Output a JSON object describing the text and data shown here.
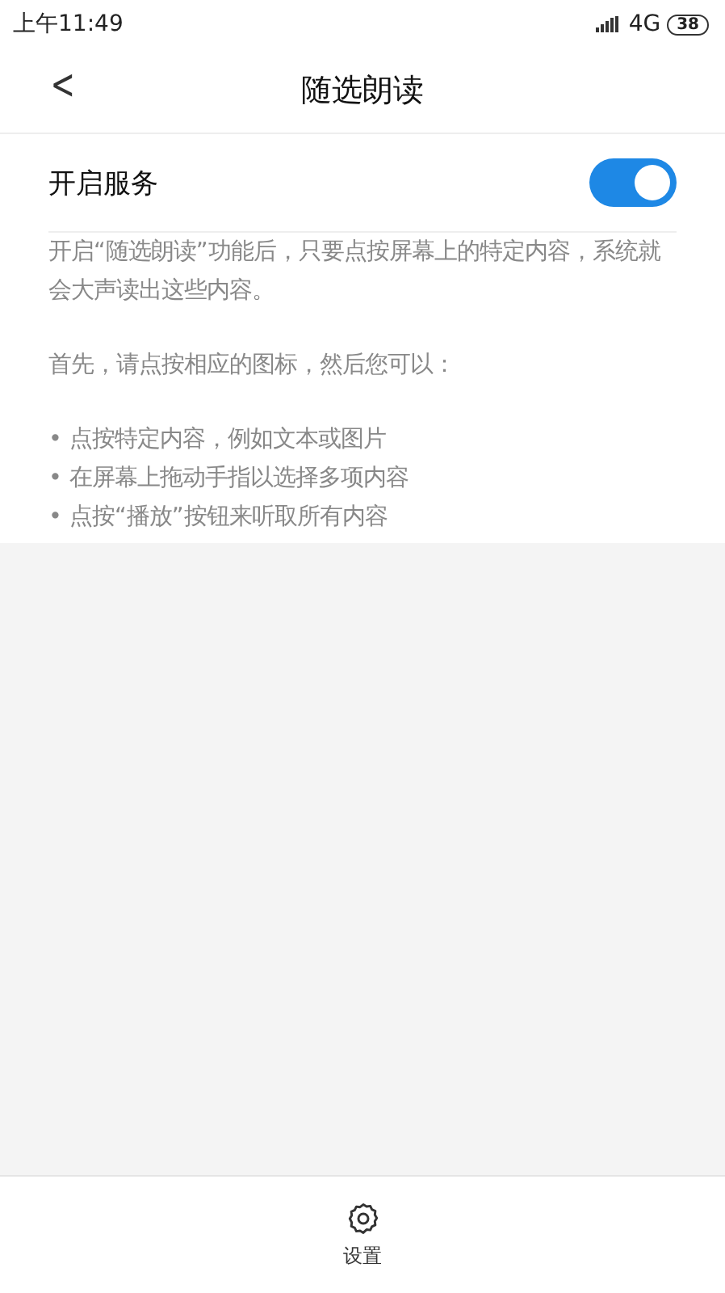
{
  "status_bar": {
    "time": "上午11:49",
    "network": "4G",
    "battery": "38"
  },
  "header": {
    "back": "<",
    "title": "随选朗读"
  },
  "service": {
    "label": "开启服务",
    "on": true
  },
  "description": [
    "开启“随选朗读”功能后，只要点按屏幕上的特定内容，系统就会大声读出这些内容。",
    "首先，请点按相应的图标，然后您可以："
  ],
  "bullets": [
    "• 点按特定内容，例如文本或图片",
    "• 在屏幕上拖动手指以选择多项内容",
    "• 点按“播放”按钮来听取所有内容"
  ],
  "bottom_bar": {
    "label": "设置"
  }
}
